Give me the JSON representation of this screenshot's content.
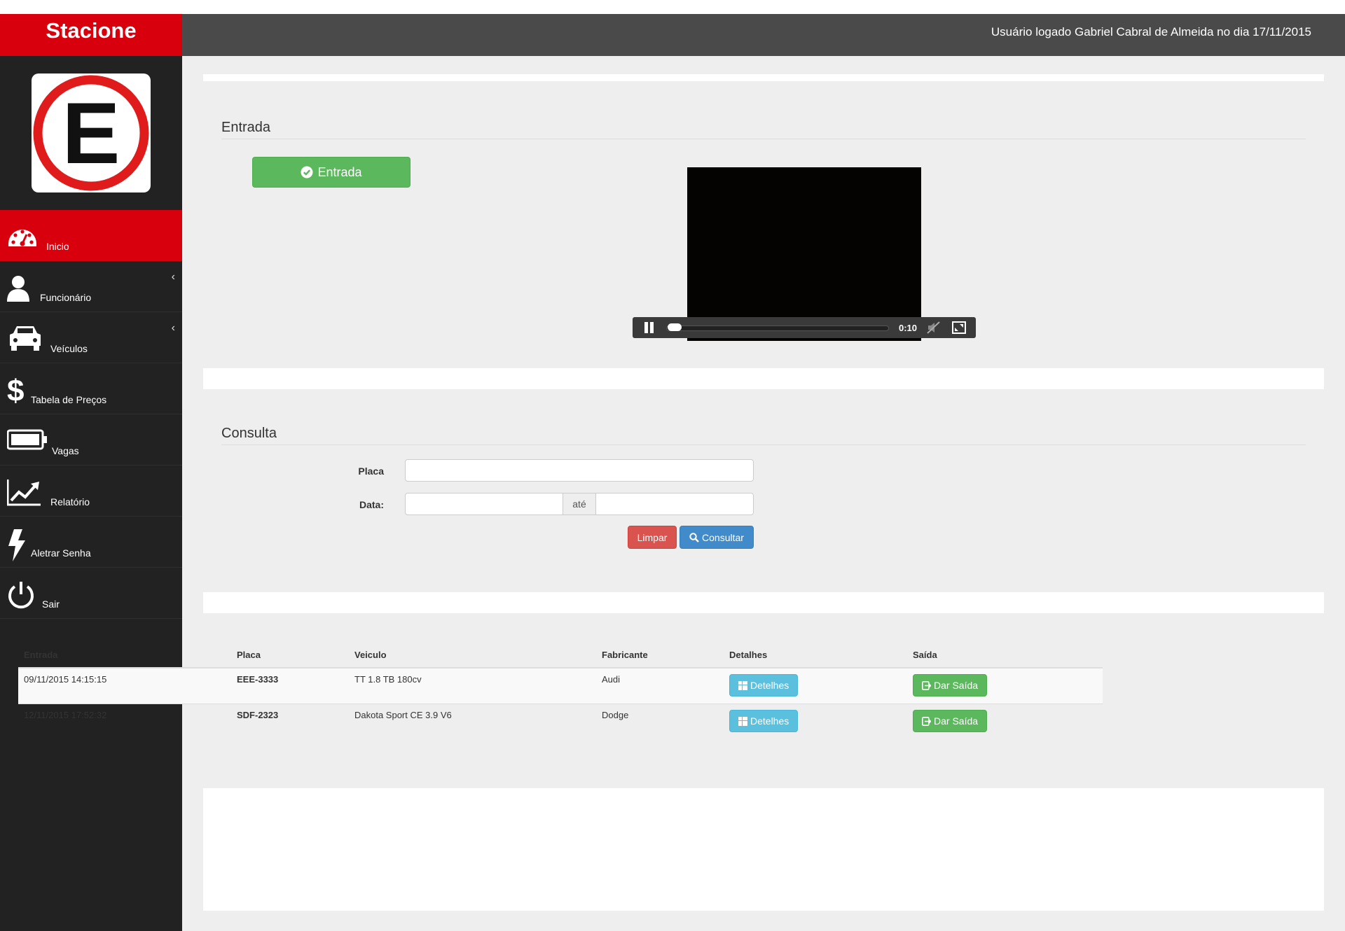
{
  "app": {
    "brand": "Stacione",
    "user_status": "Usuário logado Gabriel Cabral de Almeida no dia 17/11/2015",
    "logo_letter": "E"
  },
  "sidebar": {
    "items": [
      {
        "label": "Inicio",
        "icon": "dashboard-icon",
        "active": true
      },
      {
        "label": "Funcionário",
        "icon": "user-icon",
        "chevron": "‹"
      },
      {
        "label": "Veículos",
        "icon": "car-icon",
        "chevron": "‹"
      },
      {
        "label": "Tabela de Preços",
        "icon": "dollar-icon"
      },
      {
        "label": "Vagas",
        "icon": "battery-icon"
      },
      {
        "label": "Relatório",
        "icon": "chart-line-icon"
      },
      {
        "label": "Aletrar Senha",
        "icon": "bolt-icon"
      },
      {
        "label": "Sair",
        "icon": "power-icon"
      }
    ]
  },
  "entrada": {
    "title": "Entrada",
    "button_label": "Entrada",
    "video_time": "0:10"
  },
  "consulta": {
    "title": "Consulta",
    "placa_label": "Placa",
    "data_label": "Data:",
    "ate_label": "até",
    "placa_value": "",
    "data_from_value": "",
    "data_to_value": "",
    "limpar_label": "Limpar",
    "consultar_label": "Consultar"
  },
  "table": {
    "headers": [
      "Entrada",
      "Placa",
      "Veiculo",
      "Fabricante",
      "Detalhes",
      "Saída"
    ],
    "rows": [
      {
        "entrada": "09/11/2015 14:15:15",
        "placa": "EEE-3333",
        "veiculo": "TT 1.8 TB 180cv",
        "fabricante": "Audi",
        "detalhes": "Detelhes",
        "saida": "Dar Saída"
      },
      {
        "entrada": "12/11/2015 17:52:32",
        "placa": "SDF-2323",
        "veiculo": "Dakota Sport CE 3.9 V6",
        "fabricante": "Dodge",
        "detalhes": "Detelhes",
        "saida": "Dar Saída"
      }
    ]
  },
  "colors": {
    "brand_red": "#d9000d",
    "sidebar_bg": "#222222",
    "topbar_bg": "#4a4a4a",
    "success": "#5cb85c",
    "info": "#5bc0de",
    "danger": "#d9534f",
    "primary": "#428bca"
  }
}
